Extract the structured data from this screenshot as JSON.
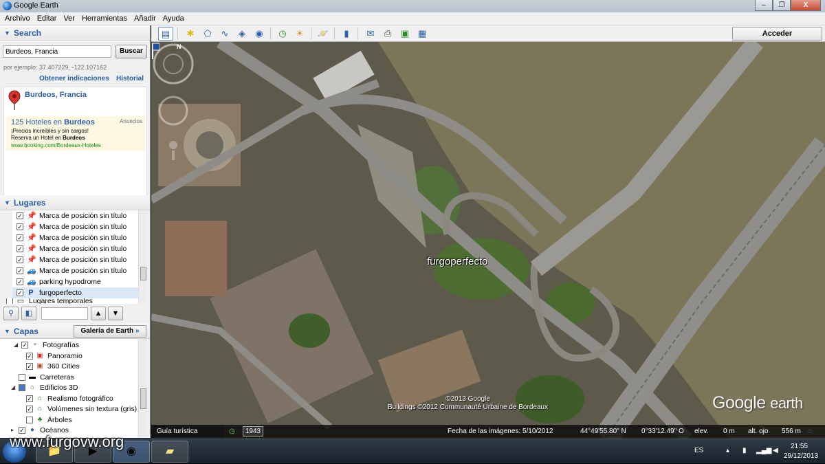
{
  "window": {
    "title": "Google Earth",
    "buttons": [
      "–",
      "❐",
      "X"
    ]
  },
  "menu": [
    "Archivo",
    "Editar",
    "Ver",
    "Herramientas",
    "Añadir",
    "Ayuda"
  ],
  "search": {
    "header": "Search",
    "input_value": "Burdeos, Francia",
    "button": "Buscar",
    "example": "por ejemplo: 37.407229, -122.107162",
    "directions_link": "Obtener indicaciones",
    "history_link": "Historial",
    "result_title": "Burdeos, Francia",
    "ad": {
      "headline_pre": "125 Hoteles en ",
      "headline_bold": "Burdeos",
      "tag": "Anuncios",
      "line1": "¡Precios increíbles y sin cargos!",
      "line2_pre": "Reserva un Hotel en ",
      "line2_bold": "Burdeos",
      "url": "www.booking.com/Bordeaux-Hoteles"
    },
    "close": "✕"
  },
  "places": {
    "header": "Lugares",
    "items": [
      {
        "label": "Marca de posición sin título",
        "icon": "green-pushpin"
      },
      {
        "label": "Marca de posición sin título",
        "icon": "green-pushpin"
      },
      {
        "label": "Marca de posición sin título",
        "icon": "yellow-pushpin"
      },
      {
        "label": "Marca de posición sin título",
        "icon": "yellow-pushpin"
      },
      {
        "label": "Marca de posición sin título",
        "icon": "yellow-pushpin"
      },
      {
        "label": "Marca de posición sin título",
        "icon": "blue-car"
      },
      {
        "label": "parking hypodrome",
        "icon": "blue-car"
      },
      {
        "label": "furgoperfecto",
        "icon": "parking-flag"
      },
      {
        "label": "Lugares temporales",
        "icon": "folder"
      }
    ]
  },
  "layers": {
    "header": "Capas",
    "gallery_button": "Galería de Earth",
    "gallery_arrows": "»",
    "items": [
      {
        "label": "Fotografías",
        "checked": true
      },
      {
        "label": "Panoramio",
        "checked": true
      },
      {
        "label": "360 Cities",
        "checked": true
      },
      {
        "label": "Carreteras",
        "checked": false
      },
      {
        "label": "Edificios 3D",
        "checked": "partial"
      },
      {
        "label": "Realismo fotográfico",
        "checked": true
      },
      {
        "label": "Volúmenes sin textura (gris)",
        "checked": true
      },
      {
        "label": "Árboles",
        "checked": false
      },
      {
        "label": "Océanos",
        "checked": true
      }
    ]
  },
  "toolbar": {
    "login": "Acceder"
  },
  "map": {
    "placemark_label": "furgoperfecto",
    "copyright_line1": "©2013 Google",
    "copyright_line2": "Buildings ©2012 Communauté Urbaine de Bordeaux",
    "logo_google": "Google",
    "logo_earth": "earth",
    "compass_north": "N"
  },
  "status": {
    "guide": "Guía turística",
    "year": "1943",
    "imagery_date": "Fecha de las imágenes: 5/10/2012",
    "lat": "44°49'55.80\" N",
    "lon": "0°33'12.49\" O",
    "elev_label": "elev.",
    "elev_value": "0 m",
    "eye_label": "alt. ojo",
    "eye_value": "556 m"
  },
  "taskbar": {
    "lang": "ES",
    "time": "21:55",
    "date": "29/12/2013"
  },
  "watermark": "www.furgovw.org"
}
